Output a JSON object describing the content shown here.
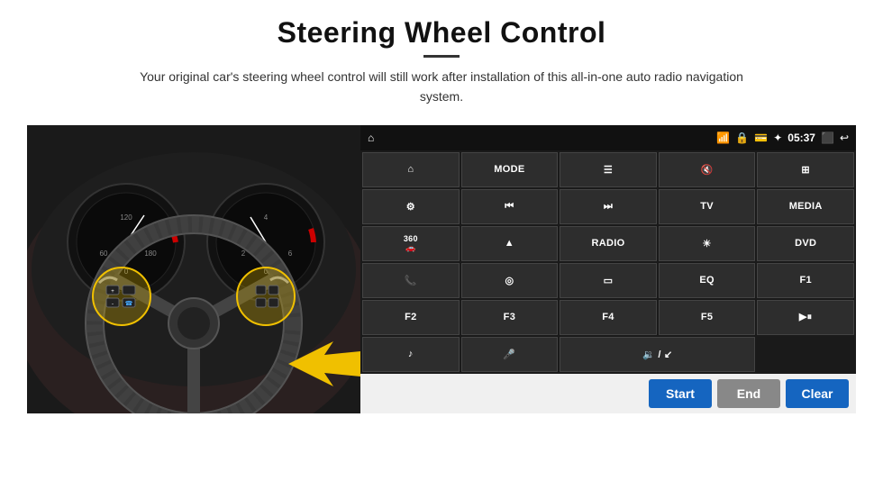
{
  "page": {
    "title": "Steering Wheel Control",
    "subtitle": "Your original car's steering wheel control will still work after installation of this all-in-one auto radio navigation system."
  },
  "statusBar": {
    "time": "05:37",
    "icons": [
      "wifi",
      "lock",
      "sd",
      "bluetooth",
      "cast",
      "back"
    ]
  },
  "buttons": [
    [
      {
        "label": "⌂",
        "icon": true
      },
      {
        "label": "MODE"
      },
      {
        "label": "☰",
        "icon": true
      },
      {
        "label": "🔇",
        "icon": true
      },
      {
        "label": "⊞",
        "icon": true
      }
    ],
    [
      {
        "label": "⊙",
        "icon": true
      },
      {
        "label": "⏮",
        "icon": true
      },
      {
        "label": "⏭",
        "icon": true
      },
      {
        "label": "TV"
      },
      {
        "label": "MEDIA"
      }
    ],
    [
      {
        "label": "360\n🚗",
        "icon": true
      },
      {
        "label": "▲",
        "icon": true
      },
      {
        "label": "RADIO"
      },
      {
        "label": "☀",
        "icon": true
      },
      {
        "label": "DVD"
      }
    ],
    [
      {
        "label": "📞",
        "icon": true
      },
      {
        "label": "◎",
        "icon": true
      },
      {
        "label": "▭",
        "icon": true
      },
      {
        "label": "EQ"
      },
      {
        "label": "F1"
      }
    ],
    [
      {
        "label": "F2"
      },
      {
        "label": "F3"
      },
      {
        "label": "F4"
      },
      {
        "label": "F5"
      },
      {
        "label": "▶⏸",
        "icon": true
      }
    ],
    [
      {
        "label": "♪",
        "icon": true
      },
      {
        "label": "🎤",
        "icon": true
      },
      {
        "label": "🔈/↙",
        "wide": true
      },
      {
        "label": "",
        "hidden": true
      },
      {
        "label": "",
        "hidden": true
      }
    ]
  ],
  "bottomBar": {
    "startLabel": "Start",
    "endLabel": "End",
    "clearLabel": "Clear"
  }
}
